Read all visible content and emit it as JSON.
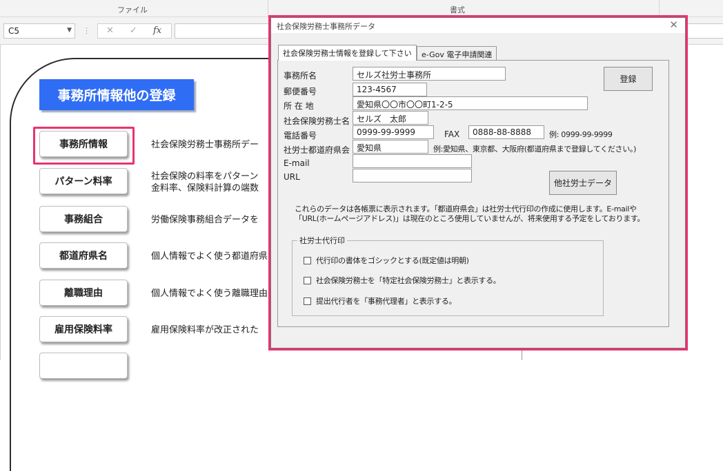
{
  "ribbon": {
    "group_file": "ファイル",
    "group_format": "書式"
  },
  "formula_bar": {
    "name_box": "C5",
    "cancel_icon": "✕",
    "enter_icon": "✓",
    "fx_icon": "fx",
    "value": ""
  },
  "sheet": {
    "title": "事務所情報他の登録",
    "menu": [
      {
        "label": "事務所情報",
        "desc_lines": [
          "社会保険労務士事務所デー"
        ]
      },
      {
        "label": "パターン料率",
        "desc_lines": [
          "社会保険の料率をパターン",
          "金料率、保険料計算の端数"
        ]
      },
      {
        "label": "事務組合",
        "desc_lines": [
          "労働保険事務組合データを"
        ]
      },
      {
        "label": "都道府県名",
        "desc_lines": [
          "個人情報でよく使う都道府県"
        ]
      },
      {
        "label": "離職理由",
        "desc_lines": [
          "個人情報でよく使う離職理由"
        ]
      },
      {
        "label": "雇用保険料率",
        "desc_lines": [
          "雇用保険料率が改正された"
        ]
      }
    ]
  },
  "dialog": {
    "title": "社会保険労務士事務所データ",
    "close_icon": "✕",
    "tabs": [
      {
        "label": "社会保険労務士情報を登録して下さい",
        "active": true
      },
      {
        "label": "e-Gov 電子申請関連",
        "active": false
      }
    ],
    "fields": {
      "office_name": {
        "label": "事務所名",
        "value": "セルズ社労士事務所"
      },
      "postal_code": {
        "label": "郵便番号",
        "value": "123-4567"
      },
      "address": {
        "label": "所 在 地",
        "value": "愛知県〇〇市〇〇町1-2-5"
      },
      "sr_name": {
        "label": "社会保険労務士名",
        "value": "セルズ　太郎"
      },
      "phone": {
        "label": "電話番号",
        "value": "0999-99-9999"
      },
      "fax": {
        "label": "FAX",
        "value": "0888-88-8888"
      },
      "prefecture_assoc": {
        "label": "社労士都道府県会",
        "value": "愛知県"
      },
      "email": {
        "label": "E-mail",
        "value": ""
      },
      "url": {
        "label": "URL",
        "value": ""
      }
    },
    "hints": {
      "phone_example": "例: 0999-99-9999",
      "prefecture_example": "例:愛知県、東京都、大阪府(都道府県まで登録してください。)"
    },
    "buttons": {
      "register": "登録",
      "other_sr_data": "他社労士データ"
    },
    "note_lines": [
      "これらのデータは各帳票に表示されます。「都道府県会」は社労士代行印の作成に使用します。E-mailや",
      "「URL(ホームページアドレス)」は現在のところ使用していませんが、将来使用する予定をしております。"
    ],
    "seal_group": {
      "title": "社労士代行印",
      "options": [
        {
          "label": "代行印の書体をゴシックとする(既定値は明朝)",
          "checked": false
        },
        {
          "label": "社会保険労務士を「特定社会保険労務士」と表示する。",
          "checked": false
        },
        {
          "label": "提出代行者を「事務代理者」と表示する。",
          "checked": false
        }
      ]
    }
  }
}
